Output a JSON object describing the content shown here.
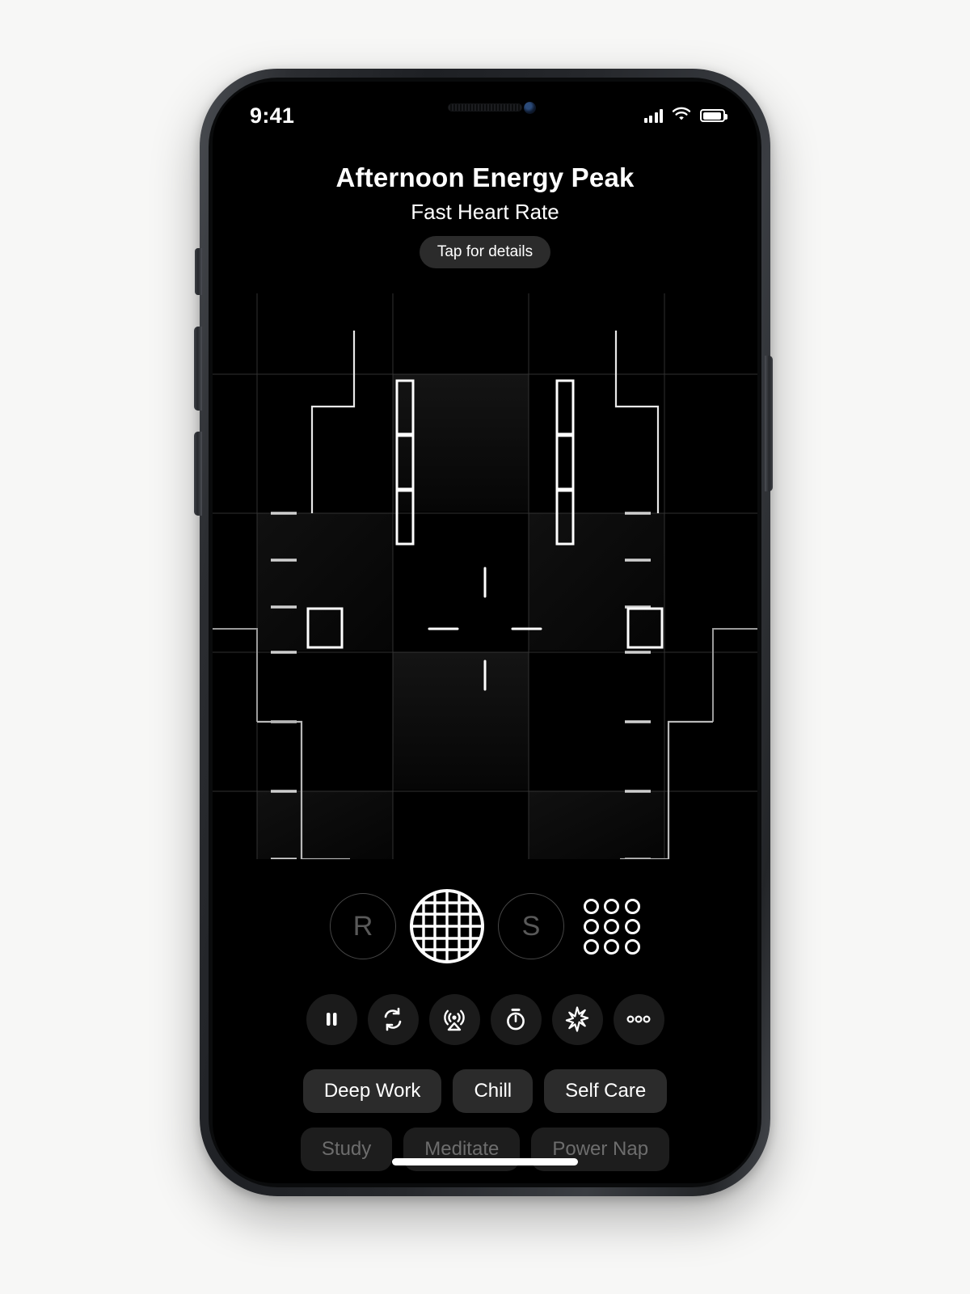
{
  "background_color": "#f7f7f6",
  "status_bar": {
    "time": "9:41",
    "icons": [
      "cellular-signal-icon",
      "wifi-icon",
      "battery-icon"
    ]
  },
  "header": {
    "title": "Afternoon Energy Peak",
    "subtitle": "Fast Heart Rate",
    "details_pill_label": "Tap for details"
  },
  "visualization": {
    "name": "abstract-face-grid-visualization",
    "grid_line_color": "#3a3a3a",
    "stroke_color": "#e8e8e8",
    "columns": 4,
    "rows": 4
  },
  "orb_row": {
    "left_label": "R",
    "right_label": "S",
    "center_icon": "globe-grid-icon",
    "dot_grid_icon": "dot-grid-icon"
  },
  "toolbar": {
    "buttons": [
      {
        "name": "pause-button",
        "icon": "pause-icon"
      },
      {
        "name": "repeat-button",
        "icon": "repeat-icon"
      },
      {
        "name": "airplay-button",
        "icon": "airplay-icon"
      },
      {
        "name": "timer-button",
        "icon": "timer-icon"
      },
      {
        "name": "sparkle-button",
        "icon": "sparkle-icon"
      },
      {
        "name": "more-options-button",
        "icon": "ellipsis-icon"
      }
    ]
  },
  "chips": {
    "primary_row": [
      "Deep Work",
      "Chill",
      "Self Care"
    ],
    "secondary_row": [
      "Study",
      "Meditate",
      "Power Nap"
    ]
  },
  "accent_colors": {
    "chip_background": "#2b2b2b",
    "toolbar_background": "#1b1b1b",
    "screen_background": "#000000",
    "text": "#ffffff"
  }
}
